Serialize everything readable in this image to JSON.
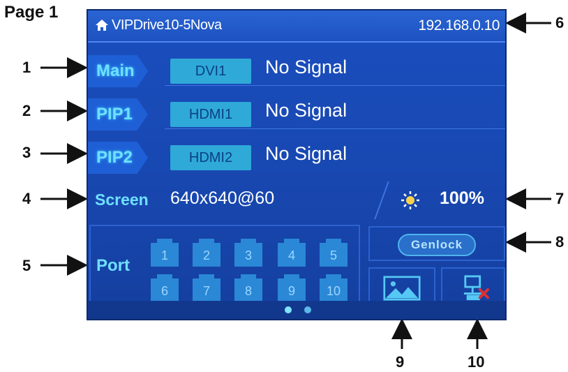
{
  "page_title": "Page 1",
  "device": {
    "name": "VIPDrive10-5Nova",
    "ip": "192.168.0.10"
  },
  "layers": [
    {
      "tag": "Main",
      "source": "DVI1",
      "signal": "No Signal"
    },
    {
      "tag": "PIP1",
      "source": "HDMI1",
      "signal": "No Signal"
    },
    {
      "tag": "PIP2",
      "source": "HDMI2",
      "signal": "No Signal"
    }
  ],
  "screen": {
    "label": "Screen",
    "resolution": "640x640@60"
  },
  "brightness": {
    "icon": "sun-icon",
    "value": "100%"
  },
  "ports": {
    "label": "Port",
    "items": [
      "1",
      "2",
      "3",
      "4",
      "5",
      "6",
      "7",
      "8",
      "9",
      "10"
    ]
  },
  "genlock": {
    "label": "Genlock"
  },
  "icons": {
    "image": "image-icon",
    "network": "network-disconnected-icon",
    "home": "home-icon"
  },
  "callouts": [
    "1",
    "2",
    "3",
    "4",
    "5",
    "6",
    "7",
    "8",
    "9",
    "10"
  ],
  "colors": {
    "screen_bg": "#1a4fbf",
    "accent_cyan": "#6fe0ff",
    "source_btn": "#2fa9d8",
    "error_red": "#e03030"
  }
}
